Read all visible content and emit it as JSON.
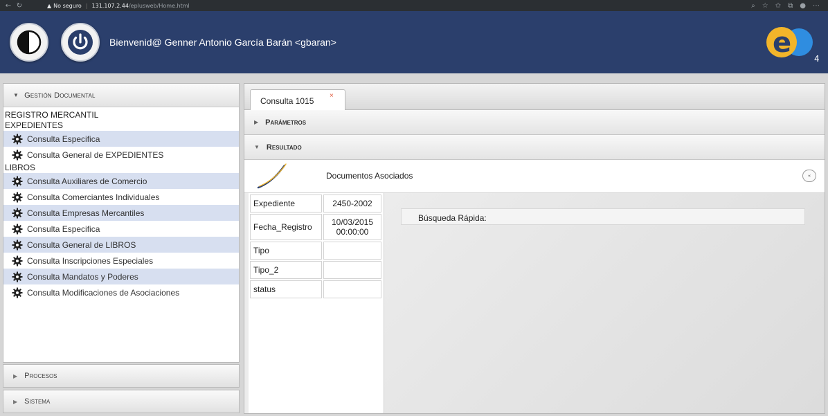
{
  "browser": {
    "security_label": "No seguro",
    "url_host": "131.107.2.44",
    "url_path": "/eplusweb/Home.html"
  },
  "header": {
    "welcome": "Bienvenid@ Genner Antonio García Barán <gbaran>",
    "logo_text": "e",
    "logo_sub": "4"
  },
  "sidebar": {
    "title": "Gestión Documental",
    "registro": "REGISTRO MERCANTIL",
    "expedientes": {
      "label": "EXPEDIENTES",
      "items": [
        "Consulta Especifica",
        "Consulta General de EXPEDIENTES"
      ]
    },
    "libros": {
      "label": "LIBROS",
      "items": [
        "Consulta Auxiliares de Comercio",
        "Consulta Comerciantes Individuales",
        "Consulta Empresas Mercantiles",
        "Consulta Especifica",
        "Consulta General de LIBROS",
        "Consulta Inscripciones Especiales",
        "Consulta Mandatos y Poderes",
        "Consulta Modificaciones de Asociaciones"
      ]
    },
    "procesos": "Procesos",
    "sistema": "Sistema"
  },
  "main": {
    "tab_label": "Consulta 1015",
    "tab_close": "×",
    "parametros": "Parámetros",
    "resultado": "Resultado",
    "doc_title": "Documentos Asociados",
    "collapse_symbol": "«",
    "props": [
      {
        "key": "Expediente",
        "value": "2450-2002"
      },
      {
        "key": "Fecha_Registro",
        "value": "10/03/2015 00:00:00"
      },
      {
        "key": "Tipo",
        "value": ""
      },
      {
        "key": "Tipo_2",
        "value": ""
      },
      {
        "key": "status",
        "value": ""
      }
    ],
    "search_label": "Búsqueda Rápida:"
  },
  "colors": {
    "header_bg": "#2b3f6c",
    "menu_alt_bg": "#d7dff0",
    "logo_yellow": "#f2b52a",
    "logo_blue": "#2f8de0",
    "close_x": "#e0573a"
  }
}
